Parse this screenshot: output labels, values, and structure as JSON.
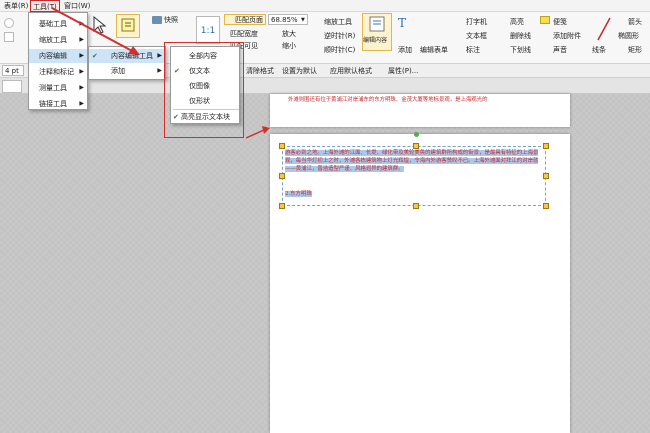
{
  "menubar": {
    "items": [
      "表单(R)",
      "工具(T)",
      "窗口(W)"
    ]
  },
  "ribbon": {
    "snapshot_label": "快照",
    "fit_page_label": "匹配页面",
    "zoom_value": "68.85%",
    "zoom_tool_label": "缩放工具",
    "fit_width_label": "匹配宽度",
    "fit_visible_label": "匹配可见",
    "zoom_in_label": "放大",
    "zoom_out_label": "缩小",
    "rotate_ccw_label": "逆时针(R)",
    "rotate_cw_label": "顺时针(C)",
    "edit_content_label": "编辑内容",
    "add_label": "添加",
    "edit_form_label": "编辑表单",
    "typewriter_label": "打字机",
    "textbox_label": "文本框",
    "callout_label": "标注",
    "highlight_label": "高亮",
    "strikeout_label": "删除线",
    "underline_label": "下划线",
    "note_label": "便笺",
    "attach_label": "添加附件",
    "sound_label": "声音",
    "line_label": "线条",
    "arrow_label": "箭头",
    "ellipse_label": "椭圆形",
    "rect_label": "矩形"
  },
  "toolbar2": {
    "font_size": "4 pt",
    "add_label": "添加",
    "clear_format_label": "清除格式",
    "set_default_label": "设置为默认",
    "apply_default_label": "应用默认格式",
    "props_label": "属性(P)..."
  },
  "tools_menu": {
    "items": [
      "基础工具",
      "缩放工具",
      "内容编辑",
      "注释和标记",
      "测量工具",
      "链接工具"
    ]
  },
  "content_edit_menu": {
    "items": [
      "内容编辑工具",
      "添加"
    ]
  },
  "content_tool_menu": {
    "items": [
      "全部内容",
      "仅文本",
      "仅图像",
      "仅形状"
    ],
    "footer": "高亮显示文本块"
  },
  "document": {
    "top_line": "外滩则围还有位于黄浦江对岸浦东的东方明珠、金茂大厦等地标景观，是上海观光的",
    "paragraph": "游客必到之地。上海外滩的江面、长堤、绿化带及美轮美奂的建筑群所构成的街景，是最具有特征的上海景观，每当华灯初上之时，外滩各栋建筑物上灯光辉煌，令海内外游客赞叹不已。上海外滩面对拜江的对岸就——黄浦江，晋浩造型严谨、风格迥异的建筑群。",
    "heading": "2.东方明珠"
  },
  "colors": {
    "accent_red": "#d32f2f",
    "selection_blue": "#a9c8ec",
    "handle_yellow": "#f2c94c"
  }
}
